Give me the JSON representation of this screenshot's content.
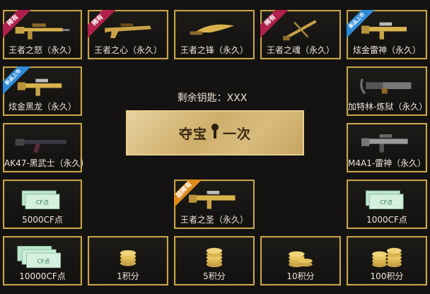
{
  "keys_remaining": {
    "label": "剩余钥匙：XXX"
  },
  "draw_button": {
    "text_left": "夺宝",
    "text_right": "一次"
  },
  "badges": {
    "rare": "稀有",
    "new_arrival": "新品上市",
    "super_rare": "超稀有"
  },
  "prizes": {
    "wangzhe_nu": "王者之怒（永久）",
    "wangzhe_xin": "王者之心（永久）",
    "wangzhe_feng": "王者之锋（永久）",
    "wangzhe_hun": "王者之魂（永久）",
    "xuanjin_leishen": "炫金雷神（永久）",
    "xuanjin_heilong": "炫金黑龙（永久）",
    "gatling": "加特林-炼狱（永久）",
    "ak47": "AK47-黑武士（永久）",
    "m4a1": "M4A1-雷神（永久）",
    "cf5000": "5000CF点",
    "wangzhe_sheng": "王者之圣（永久）",
    "cf1000": "1000CF点",
    "cf10000": "10000CF点",
    "pts1": "1积分",
    "pts5": "5积分",
    "pts10": "10积分",
    "pts100": "100积分"
  },
  "cf_note_text": "CF点"
}
